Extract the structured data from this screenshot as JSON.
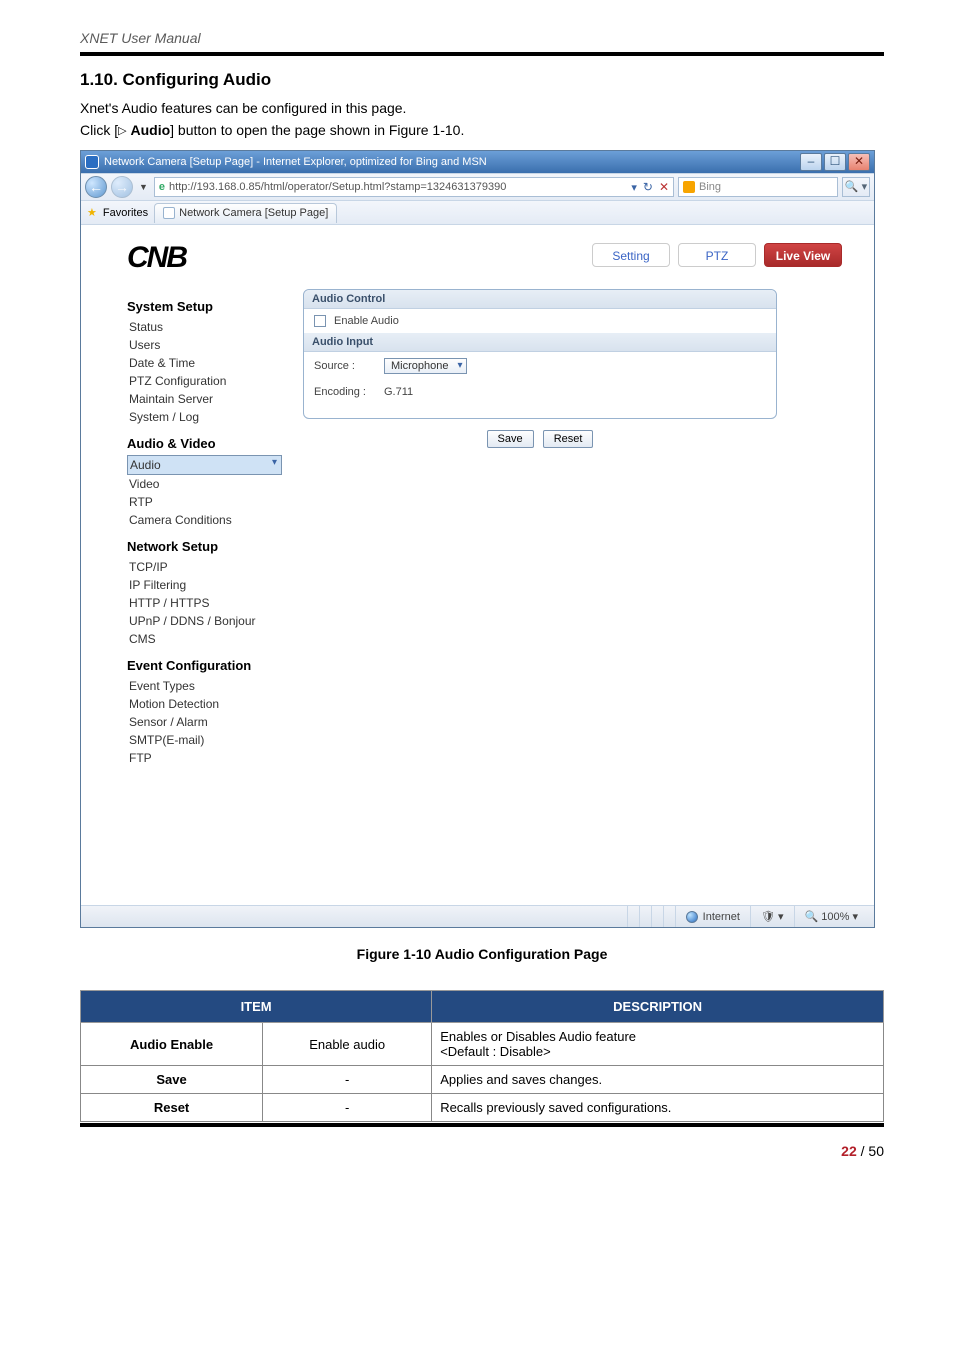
{
  "doc_header": "XNET User Manual",
  "section_title": "1.10. Configuring Audio",
  "intro": "Xnet's Audio features can be configured in this page.",
  "click_prefix": "Click [",
  "click_icon": "▷",
  "click_bold": "Audio",
  "click_suffix": "] button to open the page shown in Figure 1-10.",
  "browser": {
    "title": "Network Camera [Setup Page] - Internet Explorer, optimized for Bing and MSN",
    "win_min": "–",
    "win_max": "☐",
    "win_close": "✕",
    "back": "←",
    "fwd": "→",
    "url_prefix": "e",
    "url": "http://193.168.0.85/html/operator/Setup.html?stamp=1324631379390",
    "url_dd": "▾",
    "url_ref": "↻",
    "url_x": "✕",
    "search_placeholder": "Bing",
    "magnify": "🔍 ▾",
    "fav_label": "Favorites",
    "tab_label": "Network Camera [Setup Page]"
  },
  "page": {
    "logo": "CNB",
    "btn_setting": "Setting",
    "btn_ptz": "PTZ",
    "btn_live": "Live View",
    "side": {
      "g1": "System Setup",
      "g1i": [
        "Status",
        "Users",
        "Date & Time",
        "PTZ Configuration",
        "Maintain Server",
        "System / Log"
      ],
      "g2": "Audio & Video",
      "g2i": [
        "Audio",
        "Video",
        "RTP",
        "Camera Conditions"
      ],
      "g3": "Network Setup",
      "g3i": [
        "TCP/IP",
        "IP Filtering",
        "HTTP / HTTPS",
        "UPnP / DDNS / Bonjour",
        "CMS"
      ],
      "g4": "Event Configuration",
      "g4i": [
        "Event Types",
        "Motion Detection",
        "Sensor / Alarm",
        "SMTP(E-mail)",
        "FTP"
      ]
    },
    "panel": {
      "h1": "Audio Control",
      "enable": "Enable Audio",
      "h2": "Audio Input",
      "source_lbl": "Source :",
      "source_val": "Microphone",
      "encoding_lbl": "Encoding :",
      "encoding_val": "G.711",
      "save": "Save",
      "reset": "Reset"
    },
    "status": {
      "internet": "Internet",
      "zone": "▾",
      "zoom": "100%  ▾",
      "zoom_icon": "🔍"
    }
  },
  "caption": "Figure 1-10 Audio Configuration Page",
  "table": {
    "h_item": "ITEM",
    "h_desc": "DESCRIPTION",
    "r1a": "Audio Enable",
    "r1b": "Enable audio",
    "r1c": "Enables or Disables Audio feature\n<Default : Disable>",
    "r2a": "Save",
    "r2b": "-",
    "r2c": "Applies and saves changes.",
    "r3a": "Reset",
    "r3b": "-",
    "r3c": "Recalls previously saved configurations."
  },
  "footer": {
    "cur": "22",
    "sep": " / ",
    "tot": "50"
  }
}
